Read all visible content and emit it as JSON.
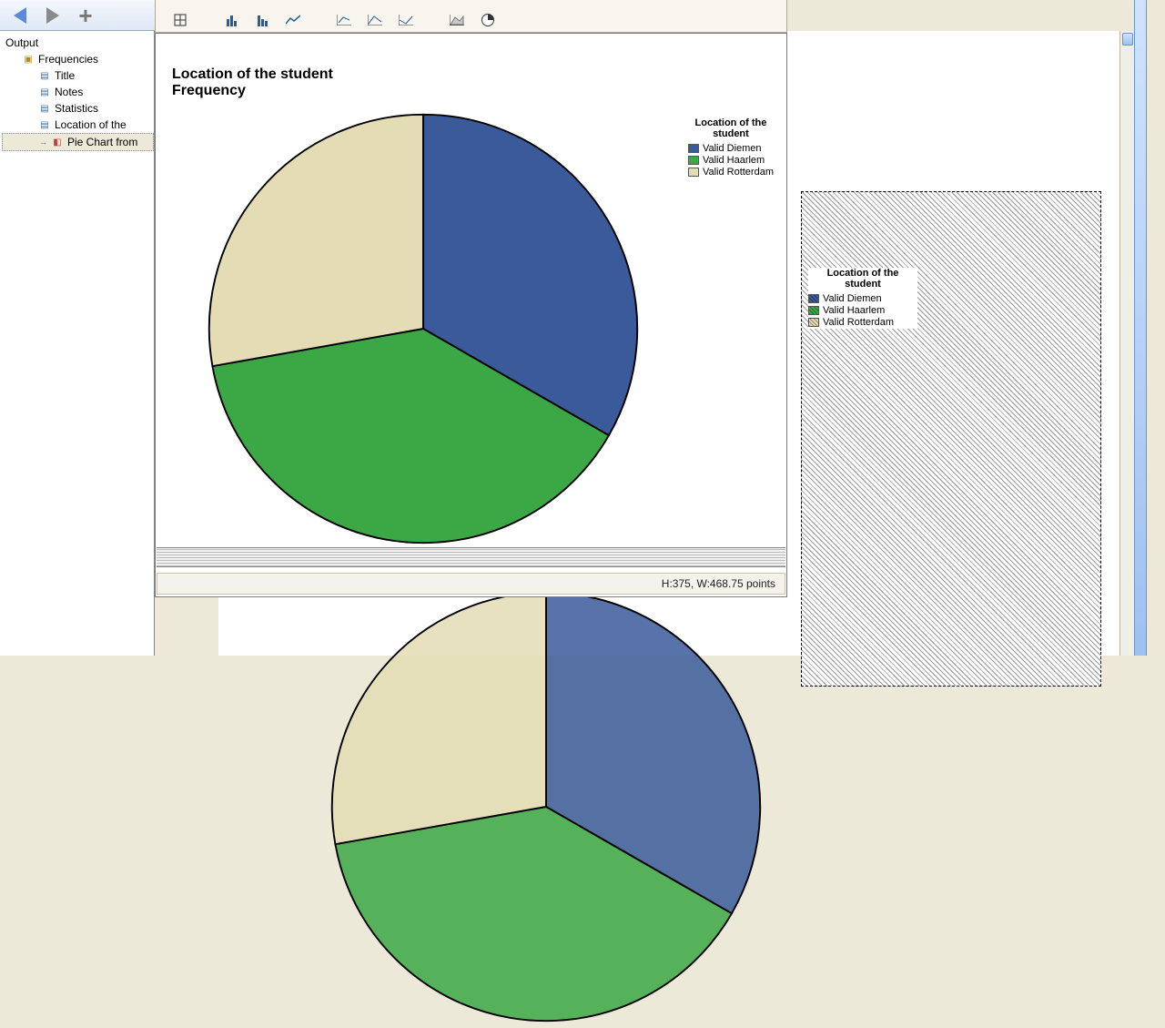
{
  "outline": {
    "root": "Output",
    "group": "Frequencies",
    "items": [
      "Title",
      "Notes",
      "Statistics",
      "Location of the",
      "Pie Chart from"
    ]
  },
  "chart": {
    "title_line1": "Location of the student",
    "title_line2": "Frequency",
    "legend_title": "Location of the\nstudent"
  },
  "status": "H:375, W:468.75 points",
  "chart_data": {
    "type": "pie",
    "title": "Location of the student — Frequency",
    "series": [
      {
        "name": "Valid Diemen",
        "value": 33.3,
        "color": "#3b5a9a"
      },
      {
        "name": "Valid Haarlem",
        "value": 38.9,
        "color": "#3ba845"
      },
      {
        "name": "Valid Rotterdam",
        "value": 27.8,
        "color": "#e3dcb4"
      }
    ],
    "legend_position": "right"
  }
}
